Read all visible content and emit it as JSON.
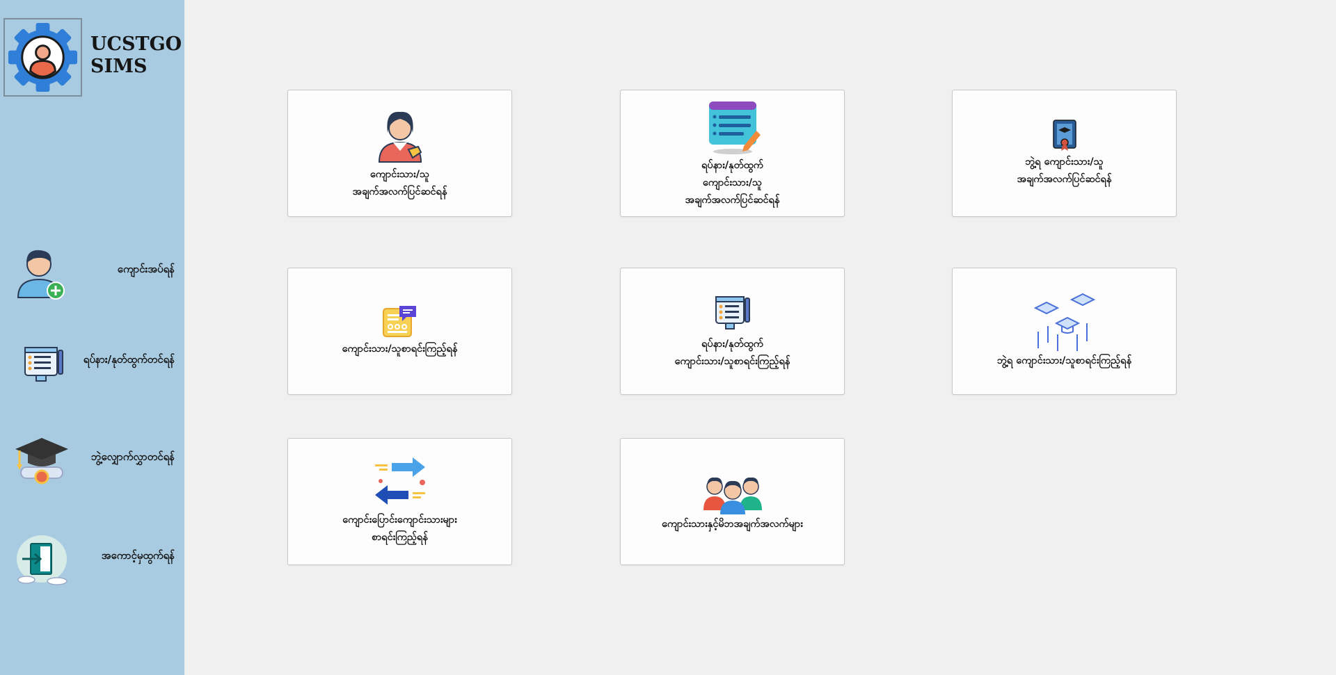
{
  "app": {
    "title_line1": "UCSTGO",
    "title_line2": "SIMS"
  },
  "sidebar": {
    "items": [
      {
        "icon": "add-user-icon",
        "label": "ကျောင်းအပ်ရန်"
      },
      {
        "icon": "exam-form-icon",
        "label": "ရပ်နား/နုတ်ထွက်တင်ရန်"
      },
      {
        "icon": "graduation-cap-icon",
        "label": "ဘွဲ့လျှောက်လွှာတင်ရန်"
      },
      {
        "icon": "logout-icon",
        "label": "အကောင့်မှထွက်ရန်"
      }
    ]
  },
  "cards": [
    {
      "icon": "student-edit-icon",
      "lines": [
        "ကျောင်းသား/သူ",
        "အချက်အလက်ပြင်ဆင်ရန်"
      ]
    },
    {
      "icon": "form-edit-icon",
      "lines": [
        "ရပ်နား/နုတ်ထွက်",
        "ကျောင်းသား/သူ",
        "အချက်အလက်ပြင်ဆင်ရန်"
      ]
    },
    {
      "icon": "certificate-icon",
      "lines": [
        "ဘွဲ့ရ ကျောင်းသား/သူ",
        "အချက်အလက်ပြင်ဆင်ရန်"
      ]
    },
    {
      "icon": "student-list-icon",
      "lines": [
        "ကျောင်းသား/သူစာရင်းကြည့်ရန်"
      ]
    },
    {
      "icon": "exam-list-icon",
      "lines": [
        "ရပ်နား/နုတ်ထွက်",
        "ကျောင်းသား/သူစာရင်းကြည့်ရန်"
      ]
    },
    {
      "icon": "graduation-caps-icon",
      "lines": [
        "ဘွဲ့ရ ကျောင်းသား/သူစာရင်းကြည့်ရန်"
      ]
    },
    {
      "icon": "transfer-arrows-icon",
      "lines": [
        "ကျောင်းပြောင်းကျောင်းသားများ",
        "စာရင်းကြည့်ရန်"
      ]
    },
    {
      "icon": "group-people-icon",
      "lines": [
        "ကျောင်းသားနှင့်မိဘအချက်အလက်များ"
      ]
    }
  ]
}
